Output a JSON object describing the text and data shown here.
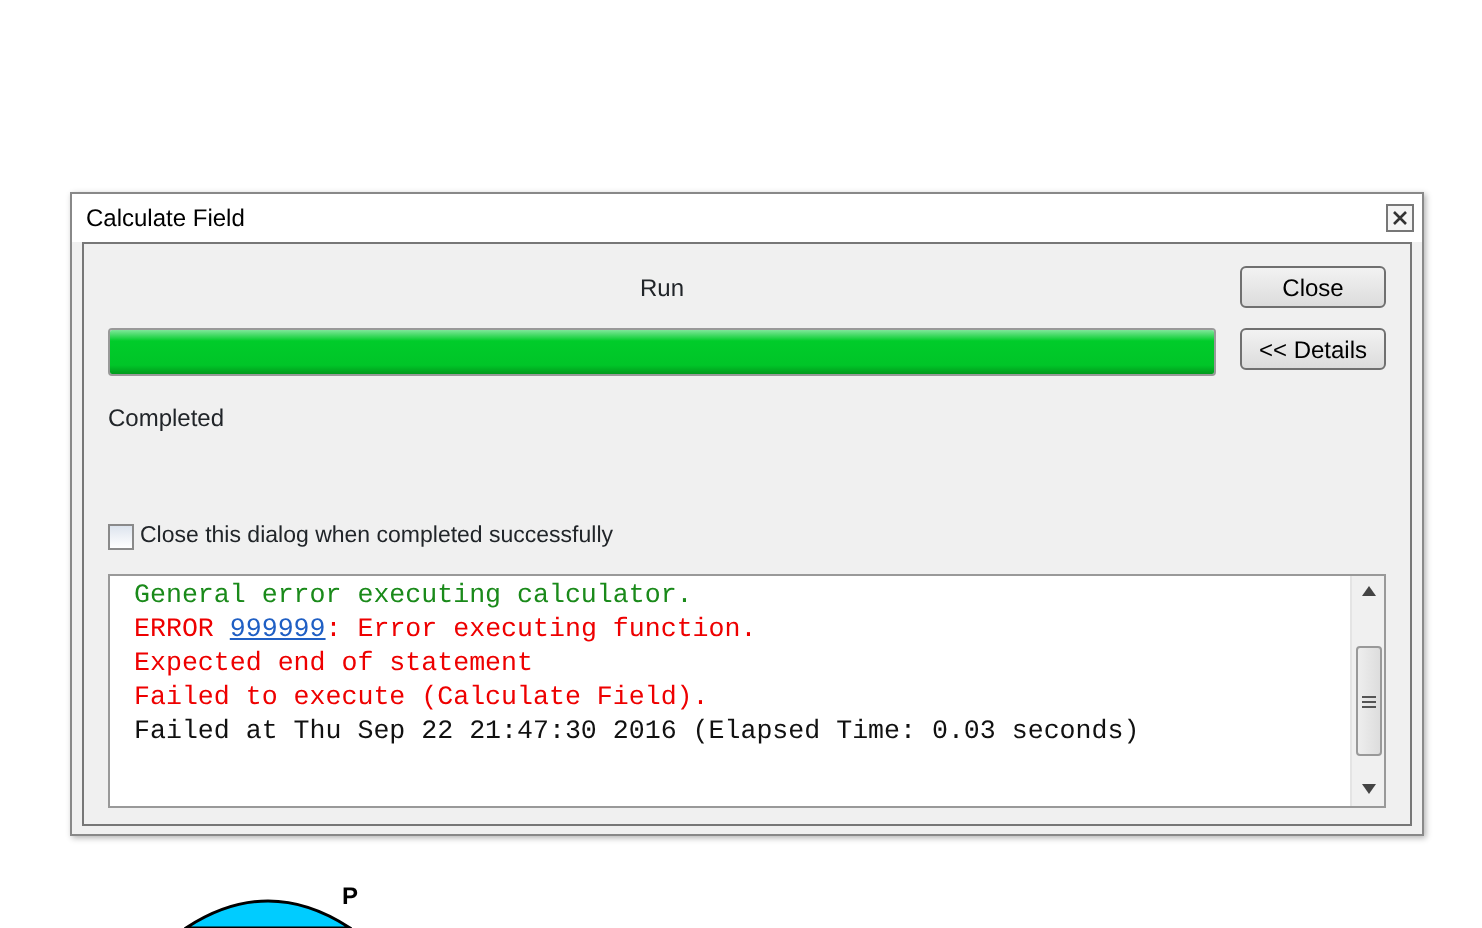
{
  "window": {
    "title": "Calculate Field"
  },
  "tool_name": "Run",
  "progress": {
    "level": 1
  },
  "status": "Completed",
  "buttons": [
    {
      "label": "Close"
    },
    {
      "label": "<< Details"
    }
  ],
  "close_when_done": {
    "label": "Close this dialog when completed successfully",
    "checked": false
  },
  "log": [
    {
      "kind": "info",
      "text": "General error executing calculator."
    },
    {
      "kind": "error",
      "text": "ERROR ",
      "link": "999999",
      "after": ": Error executing function."
    },
    {
      "kind": "error",
      "text": "Expected end of statement"
    },
    {
      "kind": "error",
      "text": "Failed to execute (Calculate Field)."
    },
    {
      "kind": "plain",
      "text": "Failed at Thu Sep 22 21:47:30 2016 (Elapsed Time: 0.03 seconds)"
    }
  ],
  "background_label": "P"
}
